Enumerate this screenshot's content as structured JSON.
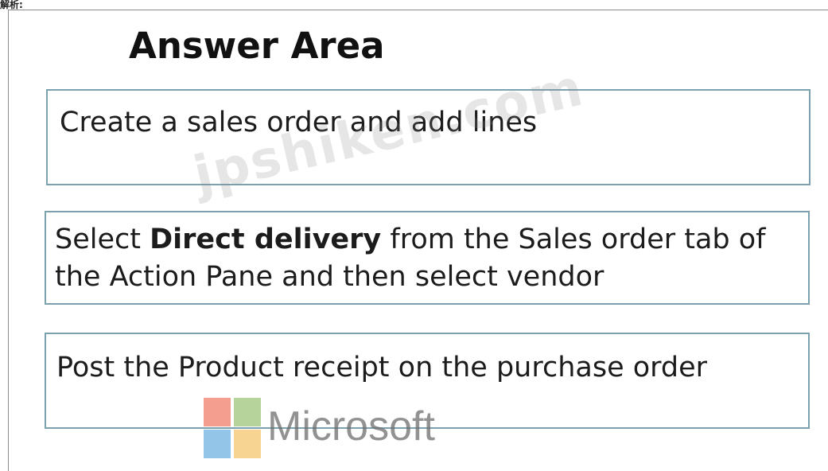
{
  "corner_label": "解析:",
  "title": "Answer Area",
  "answers": [
    {
      "text": "Create a sales order and add lines"
    },
    {
      "parts": [
        "Select ",
        "Direct delivery",
        " from the Sales order tab of the Action Pane and then select vendor"
      ]
    },
    {
      "text": "Post the Product receipt on the purchase order"
    }
  ],
  "watermark": "jpshiken.com",
  "microsoft_logo": {
    "text": "Microsoft",
    "colors": [
      "#f07e6b",
      "#9cc47a",
      "#6fb1e0",
      "#f6c66d"
    ]
  },
  "colors": {
    "box_border": "#7aa1ad",
    "frame_border": "#8c8c8c"
  }
}
